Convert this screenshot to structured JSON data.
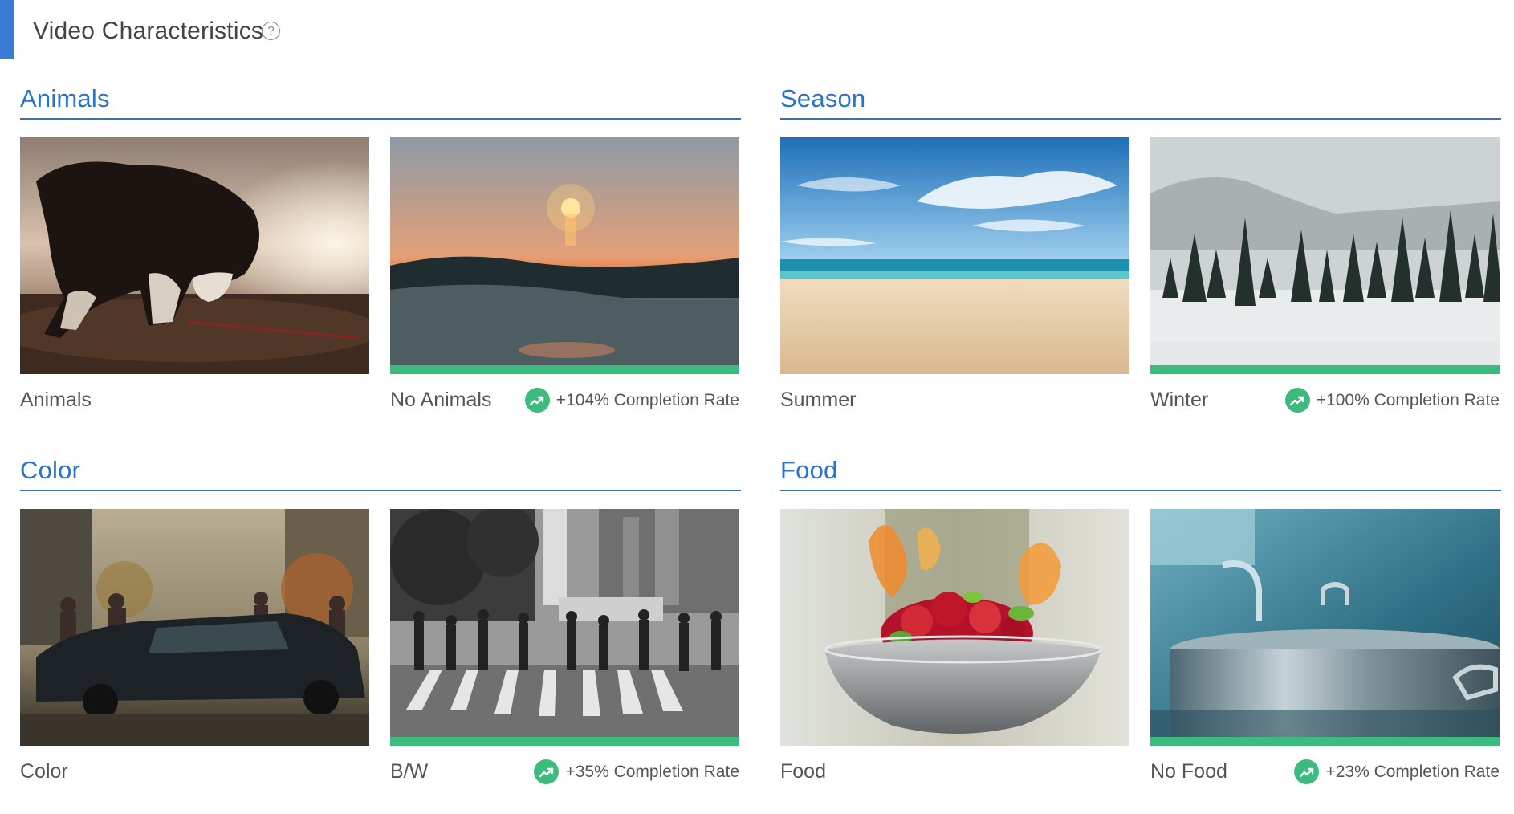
{
  "header": {
    "title": "Video Characteristics",
    "help_icon": "question-circle-icon",
    "help_glyph": "?"
  },
  "colors": {
    "accent": "#3a7bd5",
    "section_title": "#2a73c9",
    "winner": "#3dbb7e",
    "text": "#555555"
  },
  "sections": [
    {
      "title": "Animals",
      "cards": [
        {
          "label": "Animals",
          "image": "puppy-digging-on-beach",
          "winner": false
        },
        {
          "label": "No Animals",
          "image": "sunset-over-ocean-waves",
          "winner": true,
          "lift": "+104% Completion Rate",
          "lift_icon": "trending-up-icon"
        }
      ]
    },
    {
      "title": "Season",
      "cards": [
        {
          "label": "Summer",
          "image": "sunny-beach-blue-sky",
          "winner": false
        },
        {
          "label": "Winter",
          "image": "snowy-pine-forest",
          "winner": true,
          "lift": "+100% Completion Rate",
          "lift_icon": "trending-up-icon"
        }
      ]
    },
    {
      "title": "Color",
      "cards": [
        {
          "label": "Color",
          "image": "city-street-car-color",
          "winner": false
        },
        {
          "label": "B/W",
          "image": "city-crosswalk-black-and-white",
          "winner": true,
          "lift": "+35% Completion Rate",
          "lift_icon": "trending-up-icon"
        }
      ]
    },
    {
      "title": "Food",
      "cards": [
        {
          "label": "Food",
          "image": "flaming-wok-vegetables",
          "winner": false
        },
        {
          "label": "No Food",
          "image": "steel-stock-pot-kitchen",
          "winner": true,
          "lift": "+23% Completion Rate",
          "lift_icon": "trending-up-icon"
        }
      ]
    }
  ]
}
